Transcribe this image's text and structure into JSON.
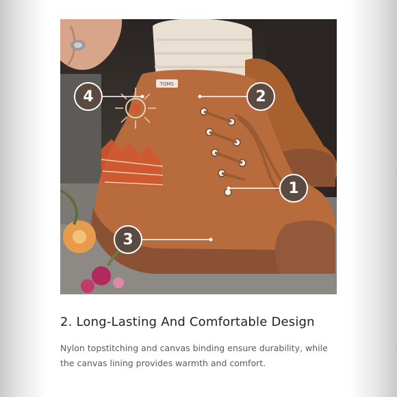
{
  "callouts": {
    "one": "1",
    "two": "2",
    "three": "3",
    "four": "4"
  },
  "shoe_brand_tag": "TOMS",
  "heading": "2. Long-Lasting And Comfortable Design",
  "description": "Nylon topstitching and canvas binding ensure durability, while the canvas lining provides warmth and comfort.",
  "colors": {
    "shoe": "#b86b3c",
    "sole": "#8a5132",
    "callout_bg": "#5a4a40",
    "heading": "#222222",
    "description": "#5a5a5a"
  }
}
